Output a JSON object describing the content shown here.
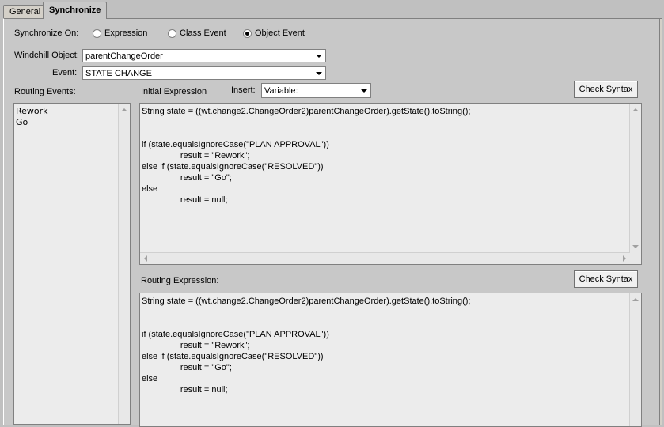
{
  "tabs": [
    {
      "label": "General"
    },
    {
      "label": "Synchronize"
    }
  ],
  "sync_on": {
    "label": "Synchronize On:",
    "options": [
      "Expression",
      "Class Event",
      "Object Event"
    ],
    "selected": "Object Event"
  },
  "windchill_object": {
    "label": "Windchill Object:",
    "value": "parentChangeOrder"
  },
  "event": {
    "label": "Event:",
    "value": "STATE CHANGE"
  },
  "routing_events": {
    "label": "Routing Events:",
    "items": [
      "Rework",
      "Go"
    ]
  },
  "initial_expression": {
    "label": "Initial Expression",
    "insert_label": "Insert:",
    "insert_value": "Variable:",
    "check_syntax_label": "Check Syntax",
    "lines": [
      "String state = ((wt.change2.ChangeOrder2)parentChangeOrder).getState().toString();",
      "",
      "",
      "if (state.equalsIgnoreCase(\"PLAN APPROVAL\"))",
      "                result = \"Rework\";",
      "else if (state.equalsIgnoreCase(\"RESOLVED\"))",
      "                result = \"Go\";",
      "else",
      "                result = null;"
    ]
  },
  "routing_expression": {
    "label": "Routing Expression:",
    "check_syntax_label": "Check Syntax",
    "lines": [
      "String state = ((wt.change2.ChangeOrder2)parentChangeOrder).getState().toString();",
      "",
      "",
      "if (state.equalsIgnoreCase(\"PLAN APPROVAL\"))",
      "                result = \"Rework\";",
      "else if (state.equalsIgnoreCase(\"RESOLVED\"))",
      "                result = \"Go\";",
      "else",
      "                result = null;"
    ]
  }
}
